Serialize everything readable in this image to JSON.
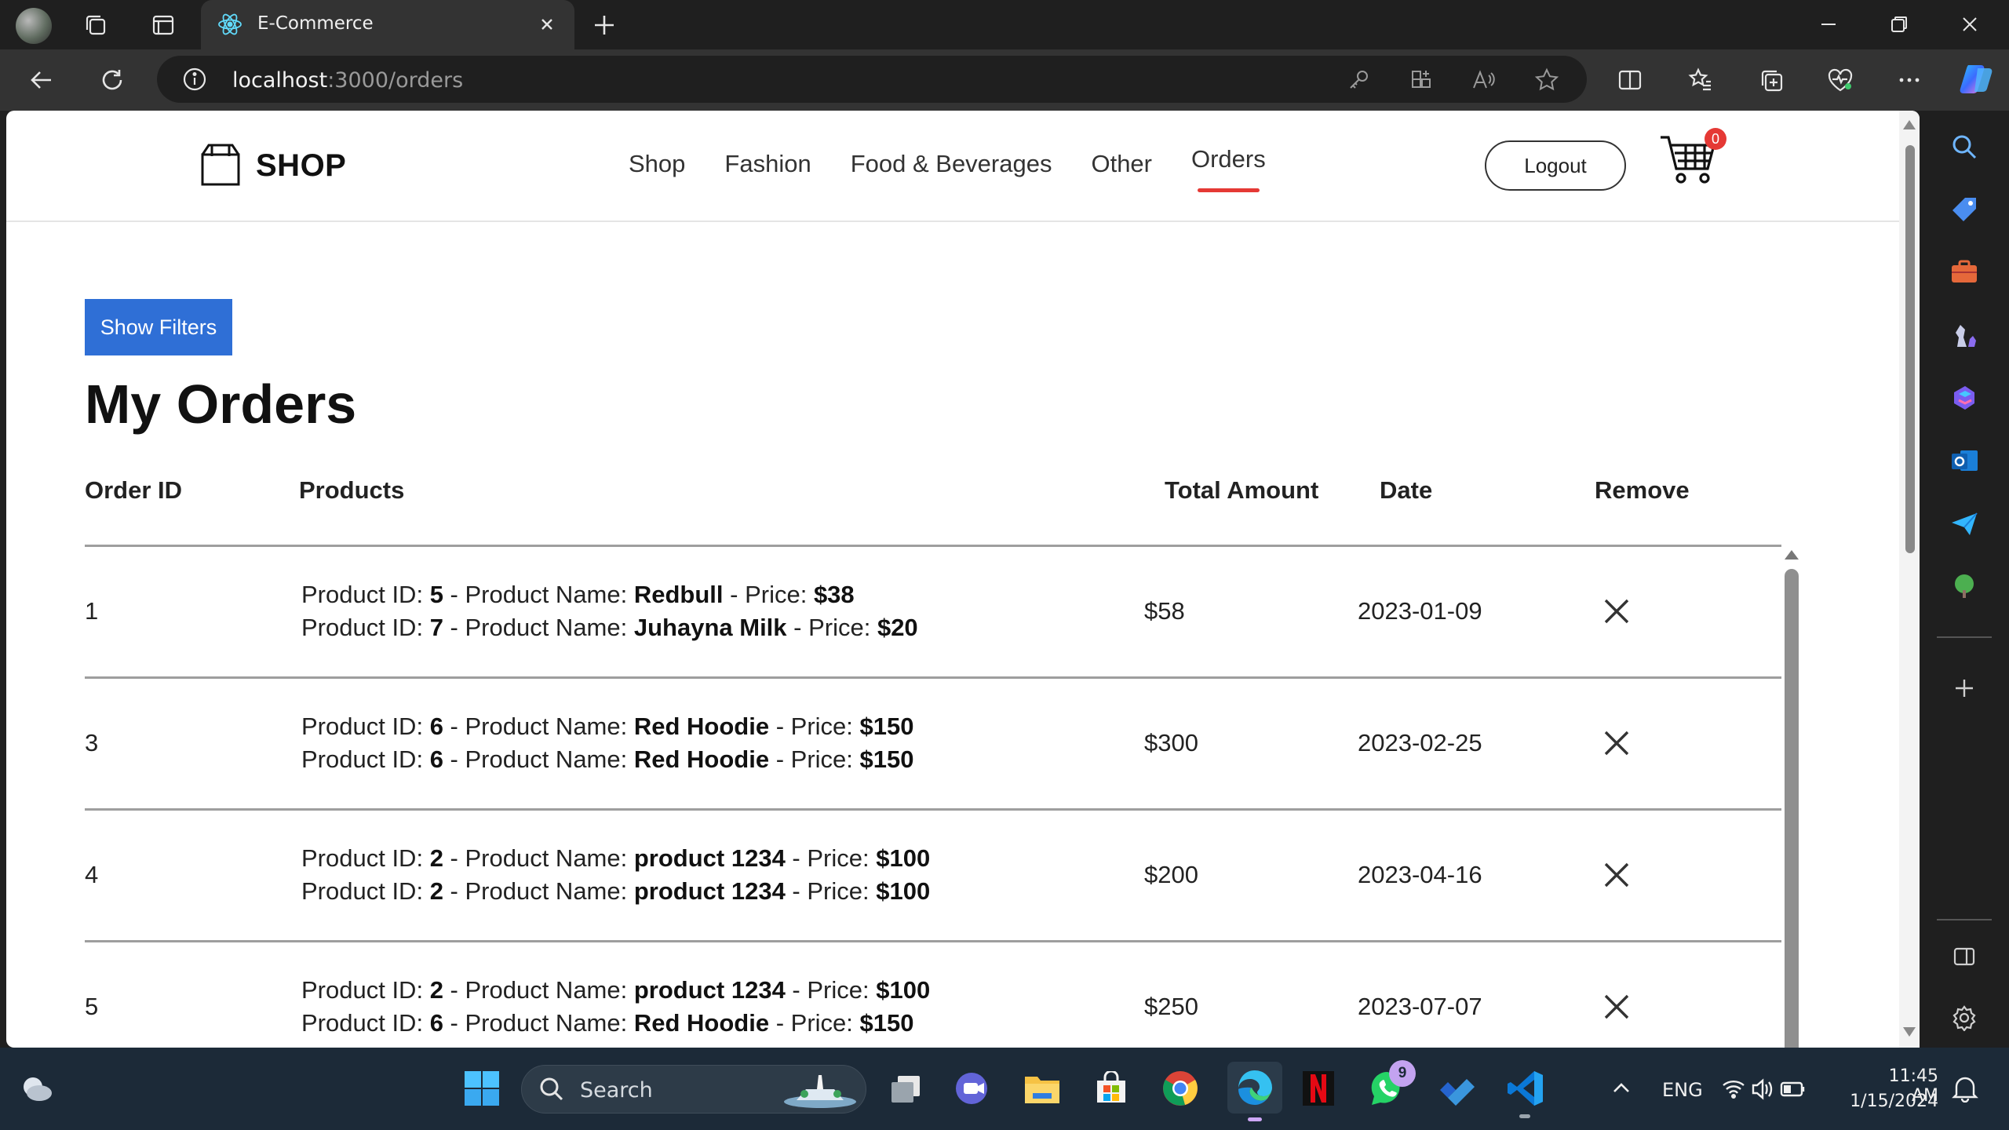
{
  "browser": {
    "tab_title": "E-Commerce",
    "url_host": "localhost",
    "url_path": ":3000/orders"
  },
  "site": {
    "brand": "SHOP",
    "nav": [
      "Shop",
      "Fashion",
      "Food & Beverages",
      "Other",
      "Orders"
    ],
    "active_nav": "Orders",
    "logout_label": "Logout",
    "cart_count": "0",
    "accent_color": "#e53935",
    "button_color": "#2f6fd6"
  },
  "orders": {
    "show_filters_label": "Show Filters",
    "heading": "My Orders",
    "columns": {
      "order_id": "Order ID",
      "products": "Products",
      "total": "Total Amount",
      "date": "Date",
      "remove": "Remove"
    },
    "product_labels": {
      "id": "Product ID: ",
      "name": " - Product Name: ",
      "price": " - Price: "
    },
    "rows": [
      {
        "id": "1",
        "products": [
          {
            "pid": "5",
            "name": "Redbull",
            "price": "$38"
          },
          {
            "pid": "7",
            "name": "Juhayna Milk",
            "price": "$20"
          }
        ],
        "total": "$58",
        "date": "2023-01-09"
      },
      {
        "id": "3",
        "products": [
          {
            "pid": "6",
            "name": "Red Hoodie",
            "price": "$150"
          },
          {
            "pid": "6",
            "name": "Red Hoodie",
            "price": "$150"
          }
        ],
        "total": "$300",
        "date": "2023-02-25"
      },
      {
        "id": "4",
        "products": [
          {
            "pid": "2",
            "name": "product 1234",
            "price": "$100"
          },
          {
            "pid": "2",
            "name": "product 1234",
            "price": "$100"
          }
        ],
        "total": "$200",
        "date": "2023-04-16"
      },
      {
        "id": "5",
        "products": [
          {
            "pid": "2",
            "name": "product 1234",
            "price": "$100"
          },
          {
            "pid": "6",
            "name": "Red Hoodie",
            "price": "$150"
          }
        ],
        "total": "$250",
        "date": "2023-07-07"
      }
    ]
  },
  "taskbar": {
    "search_label": "Search",
    "language": "ENG",
    "time": "11:45 AM",
    "date": "1/15/2024",
    "whatsapp_badge": "9"
  }
}
